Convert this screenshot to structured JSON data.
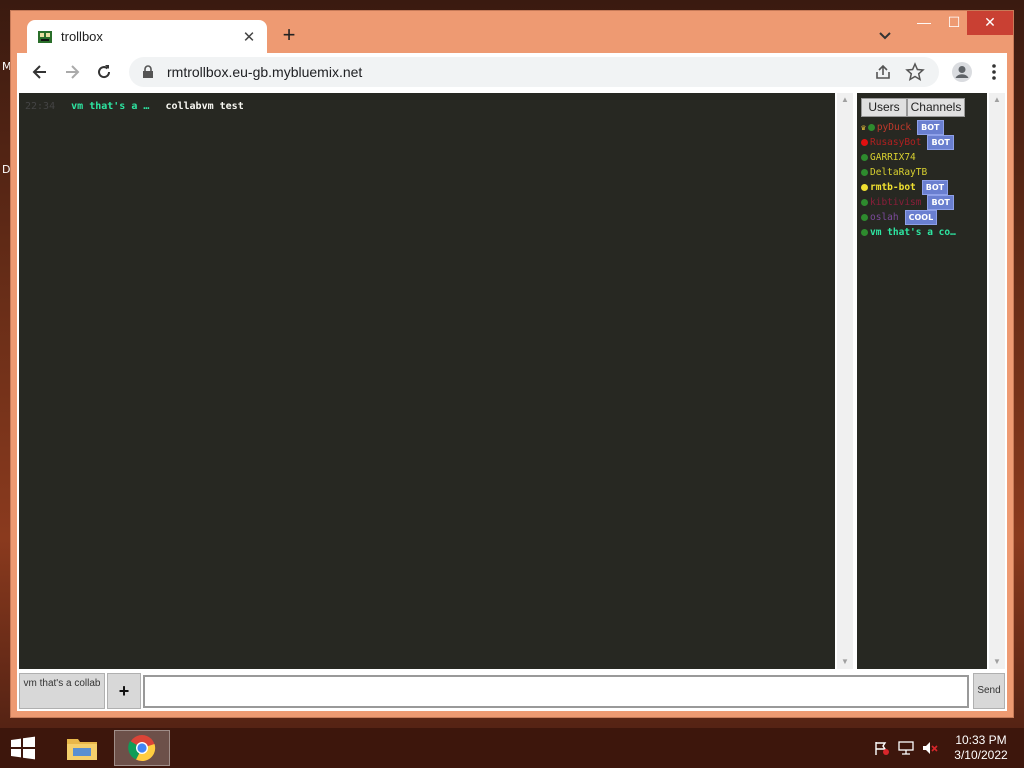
{
  "desktop": {
    "edge_letters": [
      "M",
      "D"
    ]
  },
  "browser": {
    "tab": {
      "title": "trollbox",
      "favicon": "trollbox-favicon-icon",
      "close_icon": "close-icon"
    },
    "new_tab_icon": "plus-icon",
    "tab_search_icon": "chevron-down-icon",
    "window_controls": {
      "minimize": "—",
      "maximize": "☐",
      "close": "✕"
    },
    "nav": {
      "back_icon": "back-arrow-icon",
      "forward_icon": "forward-arrow-icon",
      "reload_icon": "reload-icon"
    },
    "address": {
      "url": "rmtrollbox.eu-gb.mybluemix.net",
      "lock_icon": "lock-icon"
    },
    "toolbar_icons": [
      "share-icon",
      "star-icon",
      "profile-icon",
      "menu-dots-icon"
    ]
  },
  "trollbox": {
    "messages": [
      {
        "time": "22:34",
        "nick": "vm that's a …",
        "text": "collabvm test"
      }
    ],
    "panel_tabs": {
      "users": "Users",
      "channels": "Channels"
    },
    "users": [
      {
        "name": "pyDuck",
        "status_color": "#2e8b2e",
        "name_color": "#c0392b",
        "crown": true,
        "badge": "BOT"
      },
      {
        "name": "RusasyBot",
        "status_color": "#e01010",
        "name_color": "#b02020",
        "crown": false,
        "badge": "BOT"
      },
      {
        "name": "GARRIX74",
        "status_color": "#2e8b2e",
        "name_color": "#d8d030",
        "crown": false,
        "badge": ""
      },
      {
        "name": "DeltaRayTB",
        "status_color": "#2e8b2e",
        "name_color": "#d8d030",
        "crown": false,
        "badge": ""
      },
      {
        "name": "rmtb-bot",
        "status_color": "#f0e030",
        "name_color": "#f0e030",
        "crown": false,
        "badge": "BOT"
      },
      {
        "name": "kibtivism",
        "status_color": "#2e8b2e",
        "name_color": "#8a1e3a",
        "crown": false,
        "badge": "BOT"
      },
      {
        "name": "oslah",
        "status_color": "#2e8b2e",
        "name_color": "#7a4a9a",
        "crown": false,
        "badge": "COOL"
      },
      {
        "name": "vm that's a co…",
        "status_color": "#2e8b2e",
        "name_color": "#2ee6a2",
        "crown": false,
        "badge": ""
      }
    ],
    "channel_button": "vm that's a collab",
    "add_button": "+",
    "input": {
      "value": "",
      "placeholder": ""
    },
    "send_button": "Send"
  },
  "taskbar": {
    "start_icon": "windows-start-icon",
    "apps": [
      "file-explorer-icon",
      "chrome-icon"
    ],
    "tray_icons": [
      "action-center-flag-icon",
      "network-icon",
      "volume-muted-icon"
    ],
    "time": "10:33 PM",
    "date": "3/10/2022"
  }
}
